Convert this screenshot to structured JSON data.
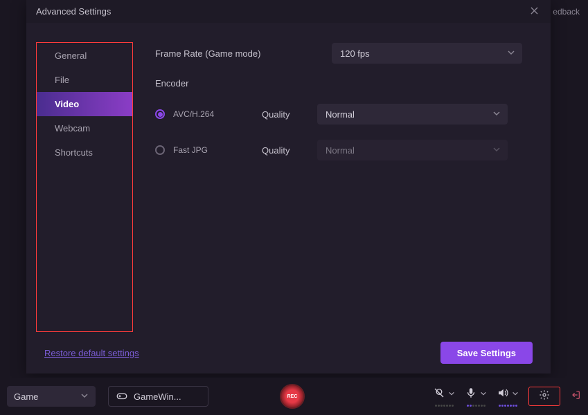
{
  "feedback_text": "edback",
  "modal": {
    "title": "Advanced Settings",
    "sidebar": {
      "items": [
        {
          "label": "General"
        },
        {
          "label": "File"
        },
        {
          "label": "Video"
        },
        {
          "label": "Webcam"
        },
        {
          "label": "Shortcuts"
        }
      ],
      "active_index": 2
    },
    "frame_rate_label": "Frame Rate (Game mode)",
    "frame_rate_value": "120 fps",
    "encoder_label": "Encoder",
    "encoders": [
      {
        "name": "AVC/H.264",
        "selected": true,
        "quality_label": "Quality",
        "quality_value": "Normal",
        "enabled": true
      },
      {
        "name": "Fast JPG",
        "selected": false,
        "quality_label": "Quality",
        "quality_value": "Normal",
        "enabled": false
      }
    ],
    "restore_label": "Restore default settings",
    "save_label": "Save Settings"
  },
  "bottom": {
    "mode_value": "Game",
    "game_value": "GameWin...",
    "rec_label": "REC"
  },
  "colors": {
    "accent": "#8a47e8",
    "highlight_border": "#ff3b3b"
  }
}
